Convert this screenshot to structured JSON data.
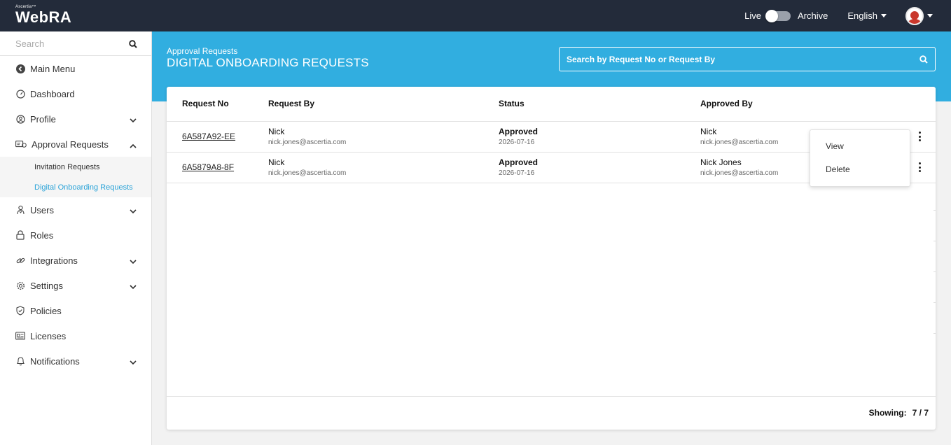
{
  "brand": {
    "tagline": "Ascertia™",
    "name": "WebRA"
  },
  "topbar": {
    "live_label": "Live",
    "archive_label": "Archive",
    "language": "English"
  },
  "sidebar": {
    "search_placeholder": "Search",
    "items": [
      {
        "label": "Main Menu",
        "icon": "back-circle-icon"
      },
      {
        "label": "Dashboard",
        "icon": "gauge-icon"
      },
      {
        "label": "Profile",
        "icon": "user-circle-icon",
        "expandable": true
      },
      {
        "label": "Approval Requests",
        "icon": "approval-icon",
        "expandable": true,
        "expanded": true
      },
      {
        "label": "Users",
        "icon": "users-icon",
        "expandable": true
      },
      {
        "label": "Roles",
        "icon": "lock-icon"
      },
      {
        "label": "Integrations",
        "icon": "link-icon",
        "expandable": true
      },
      {
        "label": "Settings",
        "icon": "gear-icon",
        "expandable": true
      },
      {
        "label": "Policies",
        "icon": "shield-icon"
      },
      {
        "label": "Licenses",
        "icon": "license-icon"
      },
      {
        "label": "Notifications",
        "icon": "bell-icon",
        "expandable": true
      }
    ],
    "sub_items": [
      {
        "label": "Invitation Requests",
        "active": false
      },
      {
        "label": "Digital Onboarding Requests",
        "active": true
      }
    ]
  },
  "main": {
    "breadcrumb": "Approval Requests",
    "title": "DIGITAL ONBOARDING REQUESTS",
    "search_placeholder": "Search by Request No or Request By"
  },
  "table": {
    "headers": {
      "request_no": "Request No",
      "request_by": "Request By",
      "status": "Status",
      "approved_by": "Approved By"
    },
    "rows": [
      {
        "request_no": "6A587A92-EE",
        "requester_name": "Nick",
        "requester_email": "nick.jones@ascertia.com",
        "status": "Approved",
        "date": "2026-07-16",
        "approver_name": "Nick",
        "approver_email": "nick.jones@ascertia.com"
      },
      {
        "request_no": "6A5879A8-8F",
        "requester_name": "Nick",
        "requester_email": "nick.jones@ascertia.com",
        "status": "Approved",
        "date": "2026-07-16",
        "approver_name": "Nick Jones",
        "approver_email": "nick.jones@ascertia.com"
      }
    ],
    "footer": {
      "showing_label": "Showing:",
      "count": "7 / 7"
    }
  },
  "row_menu": {
    "view": "View",
    "delete": "Delete"
  },
  "colors": {
    "topbar": "#232b3a",
    "accent": "#31aee0",
    "active_link": "#2aa3d8"
  }
}
